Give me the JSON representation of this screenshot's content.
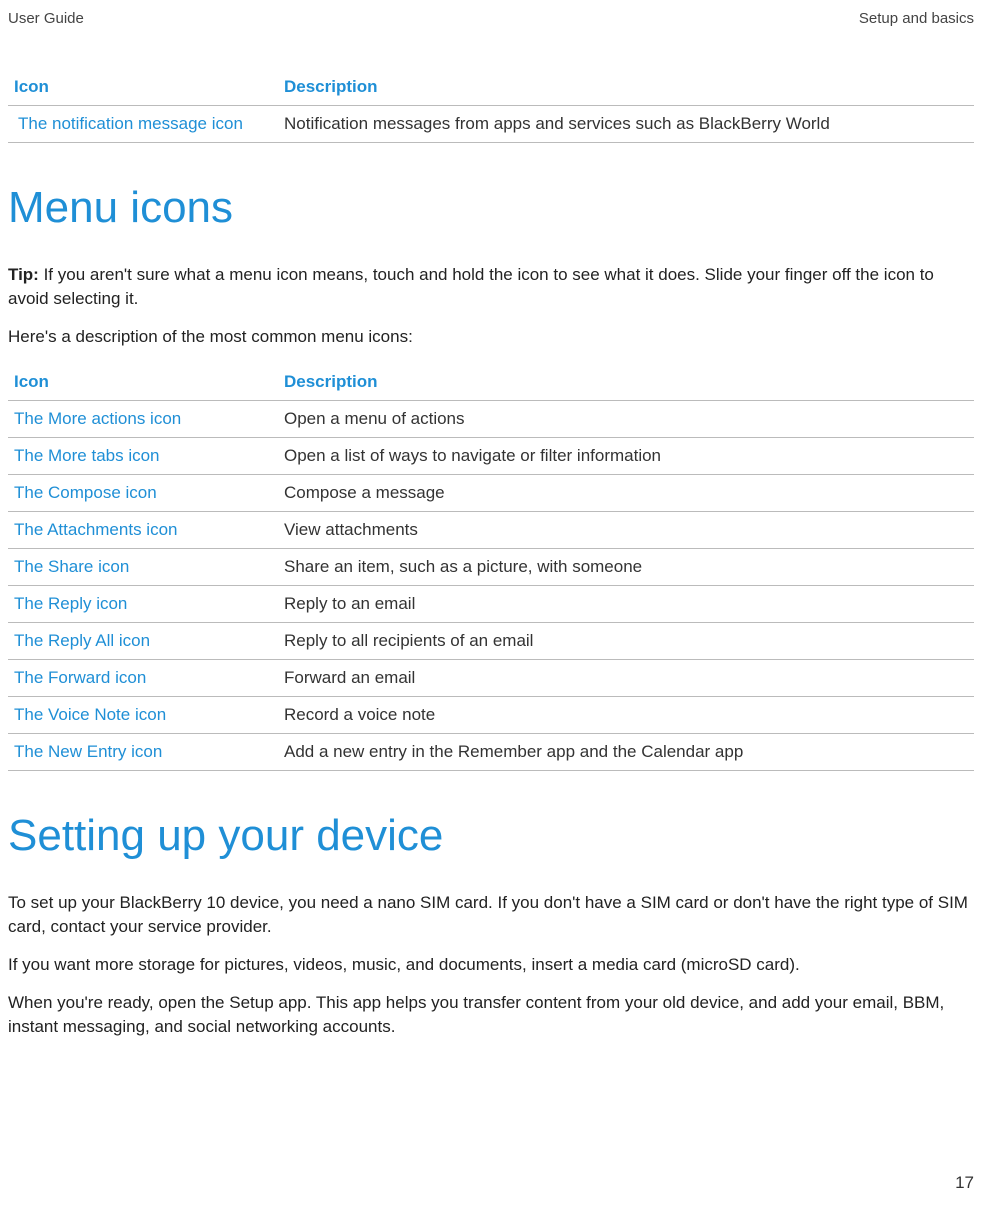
{
  "header": {
    "left": "User Guide",
    "right": "Setup and basics"
  },
  "page_number": "17",
  "table1": {
    "col1": "Icon",
    "col2": "Description",
    "rows": [
      {
        "icon": " The notification message icon",
        "desc": "Notification messages from apps and services such as BlackBerry World"
      }
    ]
  },
  "heading_menu": "Menu icons",
  "tip_label": "Tip: ",
  "tip_text": "If you aren't sure what a menu icon means, touch and hold the icon to see what it does. Slide your finger off the icon to avoid selecting it.",
  "intro_table2": "Here's a description of the most common menu icons:",
  "table2": {
    "col1": "Icon",
    "col2": "Description",
    "rows": [
      {
        "icon": "The More actions icon",
        "desc": "Open a menu of actions"
      },
      {
        "icon": "The More tabs icon",
        "desc": "Open a list of ways to navigate or filter information"
      },
      {
        "icon": "The Compose icon",
        "desc": "Compose a message"
      },
      {
        "icon": "The Attachments icon",
        "desc": "View attachments"
      },
      {
        "icon": "The Share icon",
        "desc": "Share an item, such as a picture, with someone"
      },
      {
        "icon": "The Reply icon",
        "desc": "Reply to an email"
      },
      {
        "icon": "The Reply All icon",
        "desc": "Reply to all recipients of an email"
      },
      {
        "icon": "The Forward icon",
        "desc": "Forward an email"
      },
      {
        "icon": "The Voice Note icon",
        "desc": "Record a voice note"
      },
      {
        "icon": "The New Entry icon",
        "desc": "Add a new entry in the Remember app and the Calendar app"
      }
    ]
  },
  "heading_setup": "Setting up your device",
  "setup_p1": "To set up your BlackBerry 10 device, you need a nano SIM card. If you don't have a SIM card or don't have the right type of SIM card, contact your service provider.",
  "setup_p2": "If you want more storage for pictures, videos, music, and documents, insert a media card (microSD card).",
  "setup_p3": "When you're ready, open the Setup app. This app helps you transfer content from your old device, and add your email, BBM, instant messaging, and social networking accounts."
}
